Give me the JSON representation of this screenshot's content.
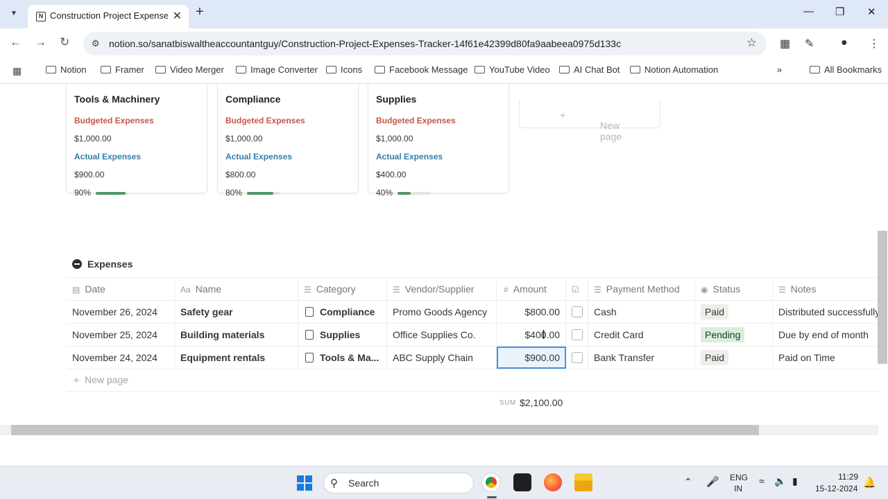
{
  "browser": {
    "tab_title": "Construction Project Expenses",
    "favicon": "N",
    "url": "notion.so/sanatbiswaltheaccountantguy/Construction-Project-Expenses-Tracker-14f61e42399d80fa9aabeea0975d133c",
    "bookmarks": [
      "Notion",
      "Framer",
      "Video Merger",
      "Image Converter",
      "Icons",
      "Facebook Message",
      "YouTube Video",
      "AI Chat Bot",
      "Notion Automation"
    ],
    "all_bookmarks": "All Bookmarks"
  },
  "cards": [
    {
      "title": "Tools & Machinery",
      "budget_label": "Budgeted Expenses",
      "budget": "$1,000.00",
      "actual_label": "Actual Expenses",
      "actual": "$900.00",
      "percent_label": "90%",
      "percent": 0.9
    },
    {
      "title": "Compliance",
      "budget_label": "Budgeted Expenses",
      "budget": "$1,000.00",
      "actual_label": "Actual Expenses",
      "actual": "$800.00",
      "percent_label": "80%",
      "percent": 0.8
    },
    {
      "title": "Supplies",
      "budget_label": "Budgeted Expenses",
      "budget": "$1,000.00",
      "actual_label": "Actual Expenses",
      "actual": "$400.00",
      "percent_label": "40%",
      "percent": 0.4
    }
  ],
  "new_page_card": "New page",
  "database": {
    "title": "Expenses",
    "columns": [
      "Date",
      "Name",
      "Category",
      "Vendor/Supplier",
      "Amount",
      "",
      "Payment Method",
      "Status",
      "Notes"
    ],
    "rows": [
      {
        "date": "November 26, 2024",
        "name": "Safety gear",
        "category": "Compliance",
        "vendor": "Promo Goods Agency",
        "amount": "$800.00",
        "method": "Cash",
        "status": "Paid",
        "notes": "Distributed successfully"
      },
      {
        "date": "November 25, 2024",
        "name": "Building materials",
        "category": "Supplies",
        "vendor": "Office Supplies Co.",
        "amount": "$400.00",
        "method": "Credit Card",
        "status": "Pending",
        "notes": "Due by end of month"
      },
      {
        "date": "November 24, 2024",
        "name": "Equipment rentals",
        "category": "Tools & Ma...",
        "vendor": "ABC Supply Chain",
        "amount": "$900.00",
        "method": "Bank Transfer",
        "status": "Paid",
        "notes": "Paid on Time"
      }
    ],
    "new_page": "New page",
    "sum_label": "SUM",
    "sum_value": "$2,100.00"
  },
  "taskbar": {
    "search": "Search",
    "lang1": "ENG",
    "lang2": "IN",
    "time": "11:29",
    "date": "15-12-2024"
  }
}
